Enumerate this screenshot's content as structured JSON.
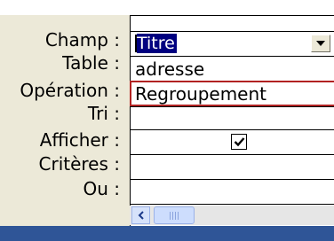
{
  "query_grid": {
    "row_labels": {
      "champ": "Champ :",
      "table": "Table :",
      "operation": "Opération :",
      "tri": "Tri :",
      "afficher": "Afficher :",
      "criteres": "Critères :",
      "ou": "Ou :"
    },
    "column": {
      "champ_value": "Titre",
      "table_value": "adresse",
      "operation_value": "Regroupement",
      "tri_value": "",
      "afficher_checked": true,
      "criteres_value": "",
      "ou_value": ""
    }
  },
  "icons": {
    "dropdown": "chevron-down-icon",
    "checkmark": "check-icon",
    "scroll_left": "arrow-left-icon"
  },
  "colors": {
    "panel": "#ece9d8",
    "selection": "#000080",
    "edit_outline": "#b22222",
    "taskbar": "#2f5597"
  }
}
